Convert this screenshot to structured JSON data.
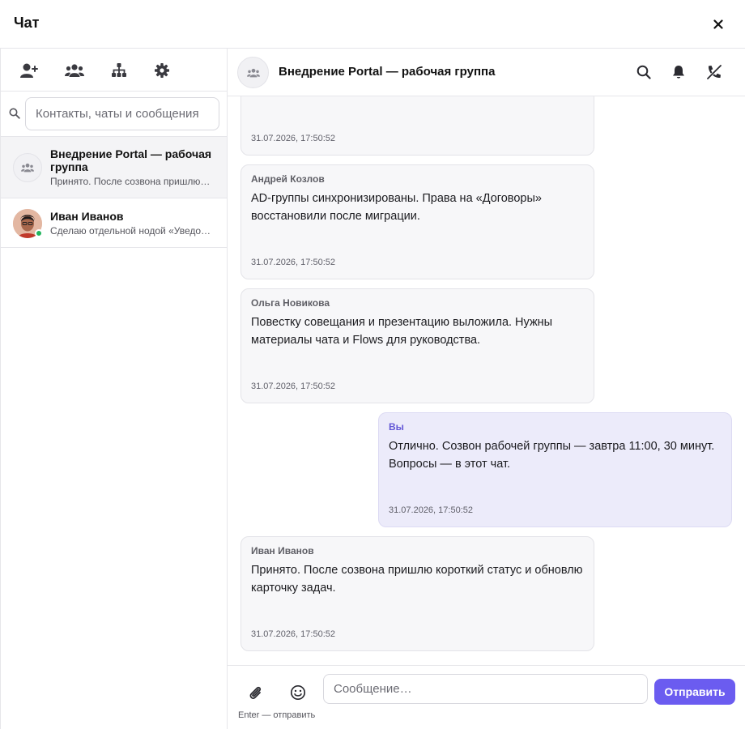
{
  "window": {
    "title": "Чат",
    "close_label": "×"
  },
  "sidebar": {
    "toolbar": [
      {
        "icon": "add-contact-icon"
      },
      {
        "icon": "group-icon"
      },
      {
        "icon": "org-structure-icon"
      },
      {
        "icon": "gear-icon"
      }
    ],
    "search": {
      "placeholder": "Контакты, чаты и сообщения"
    },
    "contacts": [
      {
        "name": "Внедрение Portal — рабочая группа",
        "preview": "Принято. После созвона пришлю короткий статус и обновлю карточку задач.",
        "active": true,
        "type": "group"
      },
      {
        "name": "Иван Иванов",
        "preview": "Сделаю отдельной нодой «Уведомление», чтобы было видно в логе.",
        "active": false,
        "type": "person",
        "online": true
      }
    ]
  },
  "chat": {
    "title": "Внедрение Portal — рабочая группа",
    "header_actions": [
      "search-icon",
      "bell-icon",
      "call-off-icon"
    ],
    "messages": [
      {
        "author": "",
        "text": "",
        "time": "31.07.2026, 17:50:52",
        "own": false
      },
      {
        "author": "Андрей Козлов",
        "text": "AD-группы синхронизированы. Права на «Договоры» восстановили после миграции.",
        "time": "31.07.2026, 17:50:52",
        "own": false
      },
      {
        "author": "Ольга Новикова",
        "text": "Повестку совещания и презентацию выложила. Нужны материалы чата и Flows для руководства.",
        "time": "31.07.2026, 17:50:52",
        "own": false
      },
      {
        "author": "Вы",
        "text": "Отлично. Созвон рабочей группы — завтра 11:00, 30 минут. Вопросы — в этот чат.",
        "time": "31.07.2026, 17:50:52",
        "own": true
      },
      {
        "author": "Иван Иванов",
        "text": "Принято. После созвона пришлю короткий статус и обновлю карточку задач.",
        "time": "31.07.2026, 17:50:52",
        "own": false
      }
    ]
  },
  "composer": {
    "placeholder": "Сообщение…",
    "send_label": "Отправить",
    "hint": "Enter — отправить"
  },
  "colors": {
    "accent": "#6b5cf0",
    "own_bubble": "#ecebfa",
    "other_bubble": "#f7f7f9",
    "online": "#22b55d"
  }
}
